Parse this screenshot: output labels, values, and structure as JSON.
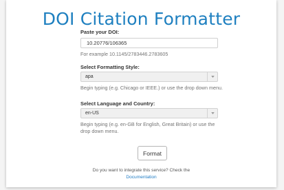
{
  "title": "DOI Citation Formatter",
  "doi": {
    "label": "Paste your DOI:",
    "value": "10.20776/106365",
    "help": "For example 10.1145/2783446.2783605"
  },
  "style": {
    "label": "Select Formatting Style:",
    "value": "apa",
    "help": "Begin typing (e.g. Chicago or IEEE.) or use the drop down menu."
  },
  "locale": {
    "label": "Select Language and Country:",
    "value": "en-US",
    "help": "Begin typing (e.g. en-GB for English, Great Britain) or use the drop down menu."
  },
  "button": {
    "label": "Format"
  },
  "footer": {
    "text": "Do you want to integrate this service? Check the",
    "link": "Documentation"
  },
  "colors": {
    "accent": "#1f80c0",
    "link": "#1f7cc4"
  }
}
